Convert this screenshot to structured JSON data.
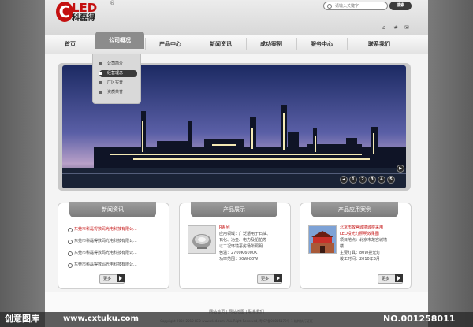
{
  "brand": {
    "logo_letter": "C",
    "logo_word": "LED",
    "reg": "®",
    "cn_name": "科磊得",
    "color": "#c41010"
  },
  "search": {
    "placeholder": "请输入关键字",
    "button": "搜索",
    "icon": "search-icon"
  },
  "utility": {
    "home_icon": "⌂",
    "star_icon": "★",
    "mail_icon": "✉"
  },
  "nav": {
    "items": [
      "首页",
      "公司概况",
      "产品中心",
      "新闻资讯",
      "成功案例",
      "服务中心",
      "联系我们"
    ],
    "active_index": 1
  },
  "dropdown": {
    "items": [
      "公司简介",
      "经营理念",
      "厂区实景",
      "资质荣誉"
    ],
    "selected_index": 1
  },
  "banner": {
    "slide_numbers": [
      "1",
      "2",
      "3",
      "4",
      "5"
    ],
    "nav_prev": "◀",
    "nav_next": "▶"
  },
  "news": {
    "title": "新闻资讯",
    "items": [
      "东莞市科磊得数码光电科技有限公...",
      "东莞市科磊得数码光电科技有限公...",
      "东莞市科磊得数码光电科技有限公...",
      "东莞市科磊得数码光电科技有限公..."
    ],
    "more": "更多"
  },
  "products": {
    "title": "产品展示",
    "name": "R系列",
    "lines": [
      "应用领域：广泛适用于石油、",
      "石化、冶金、电力及船舶等",
      "以工况环境恶劣场所照明",
      "色温：2700K-6000K",
      "功率范围：30W-80W"
    ],
    "more": "更多"
  },
  "cases": {
    "title": "产品应用案例",
    "name_lines": [
      "北京市故宫城墙城楼采用",
      "LED投光灯照明效果图"
    ],
    "lines": [
      "项目地点：北京市故宫城墙",
      "楼",
      "主要灯具：80W投光灯",
      "竣工时间：2010年3月"
    ],
    "more": "更多"
  },
  "footer": {
    "links": "网站首页 | 网站地图 | 联系我们",
    "copyright": "Copyright 2004-2010 LED www.cled.com, ALL Right Reserved, 粤ICP备08005179号-1 机构执行证证"
  },
  "watermark": {
    "left": "创意图库",
    "mid": "www.cxtuku.com",
    "right": "NO.001258011"
  }
}
